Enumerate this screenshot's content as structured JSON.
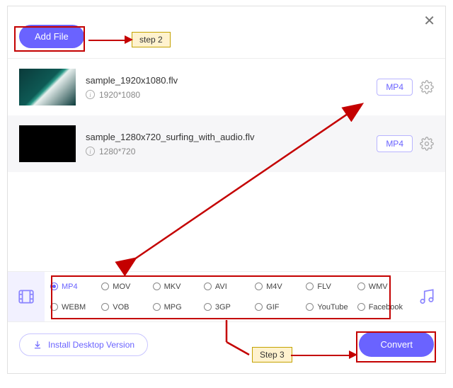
{
  "window": {
    "close": "✕"
  },
  "toolbar": {
    "add_file": "Add File"
  },
  "files": [
    {
      "name": "sample_1920x1080.flv",
      "resolution": "1920*1080",
      "target_format": "MP4"
    },
    {
      "name": "sample_1280x720_surfing_with_audio.flv",
      "resolution": "1280*720",
      "target_format": "MP4"
    }
  ],
  "formats": {
    "selected": "MP4",
    "options": [
      "MP4",
      "MOV",
      "MKV",
      "AVI",
      "M4V",
      "FLV",
      "WMV",
      "WEBM",
      "VOB",
      "MPG",
      "3GP",
      "GIF",
      "YouTube",
      "Facebook"
    ]
  },
  "footer": {
    "install": "Install Desktop Version",
    "convert": "Convert"
  },
  "annotations": {
    "step2": "step 2",
    "step3": "Step 3"
  }
}
